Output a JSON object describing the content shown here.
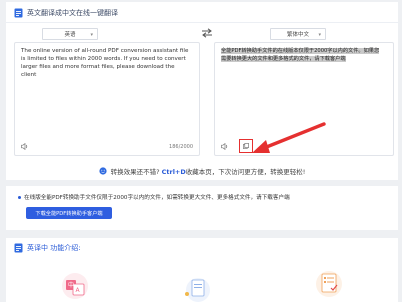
{
  "header": {
    "title": "英文翻译成中文在线一键翻译",
    "icon": "document-icon"
  },
  "translator": {
    "source_lang": "英语",
    "target_lang": "繁体中文",
    "source_text": "The online version of all-round PDF conversion assistant file is limited to files within 2000 words. If you need to convert larger files and more format files, please download the client",
    "target_text": "全能PDF转换助手文件的在线版本仅限于2000字以内的文件。如果您需要转换更大的文件和更多格式的文件，请下载客户端",
    "char_count": "186/2000",
    "accent_color": "#e53030"
  },
  "hint": {
    "prefix": "转换效果还不错?",
    "shortcut": "Ctrl+D",
    "suffix": "收藏本页，下次访问更方便，转换更轻松!"
  },
  "promo": {
    "text": "在线版全能PDF转换助手文件仅限于2000字以内的文件，如需转换更大文件、更多格式文件，请下载客户端",
    "button_label": "下载全能PDF转换助手客户端",
    "button_color": "#2f5ee0"
  },
  "intro": {
    "title": "英译中 功能介绍:"
  }
}
